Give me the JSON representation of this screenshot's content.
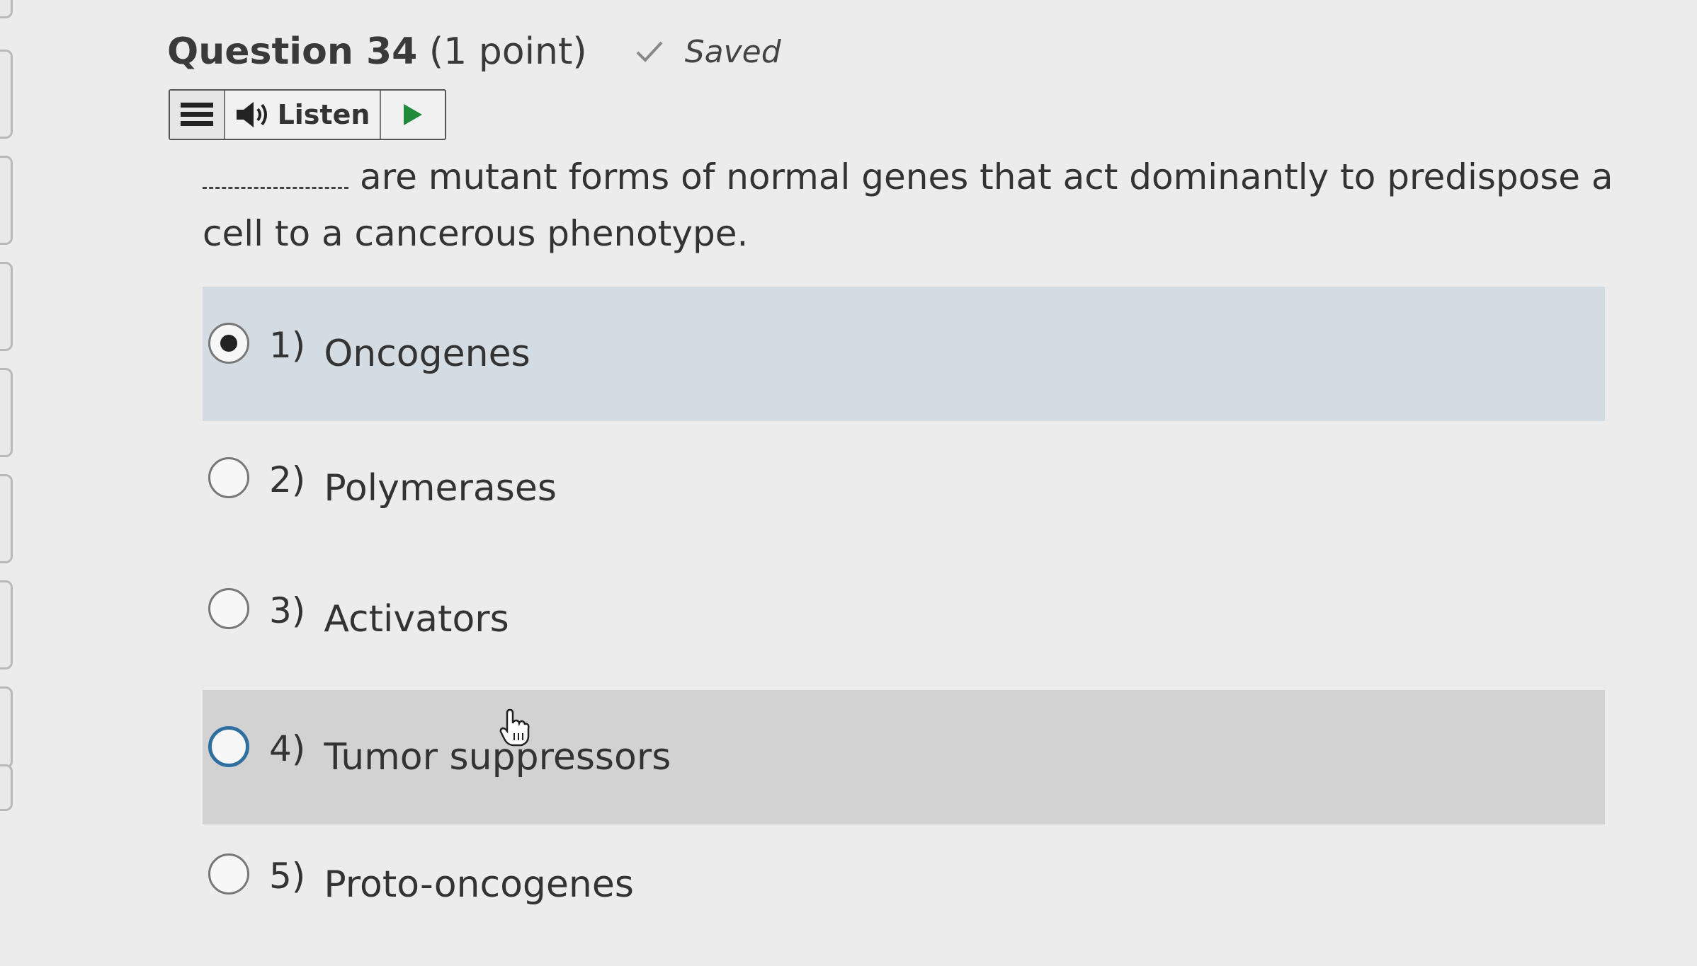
{
  "question": {
    "title_bold": "Question 34",
    "title_rest": " (1 point)",
    "status": "Saved",
    "prompt": "are mutant forms of normal genes that act dominantly to predispose a cell to a cancerous phenotype."
  },
  "toolbar": {
    "listen_label": "Listen"
  },
  "options": [
    {
      "num": "1)",
      "label": "Oncogenes",
      "selected": true
    },
    {
      "num": "2)",
      "label": "Polymerases",
      "selected": false
    },
    {
      "num": "3)",
      "label": "Activators",
      "selected": false
    },
    {
      "num": "4)",
      "label": "Tumor suppressors",
      "selected": false
    },
    {
      "num": "5)",
      "label": "Proto-oncogenes",
      "selected": false
    }
  ],
  "colors": {
    "selected_bg": "#d3dce3",
    "hover_bg": "#d2d2d2",
    "focus_ring": "#2f6f9f"
  }
}
